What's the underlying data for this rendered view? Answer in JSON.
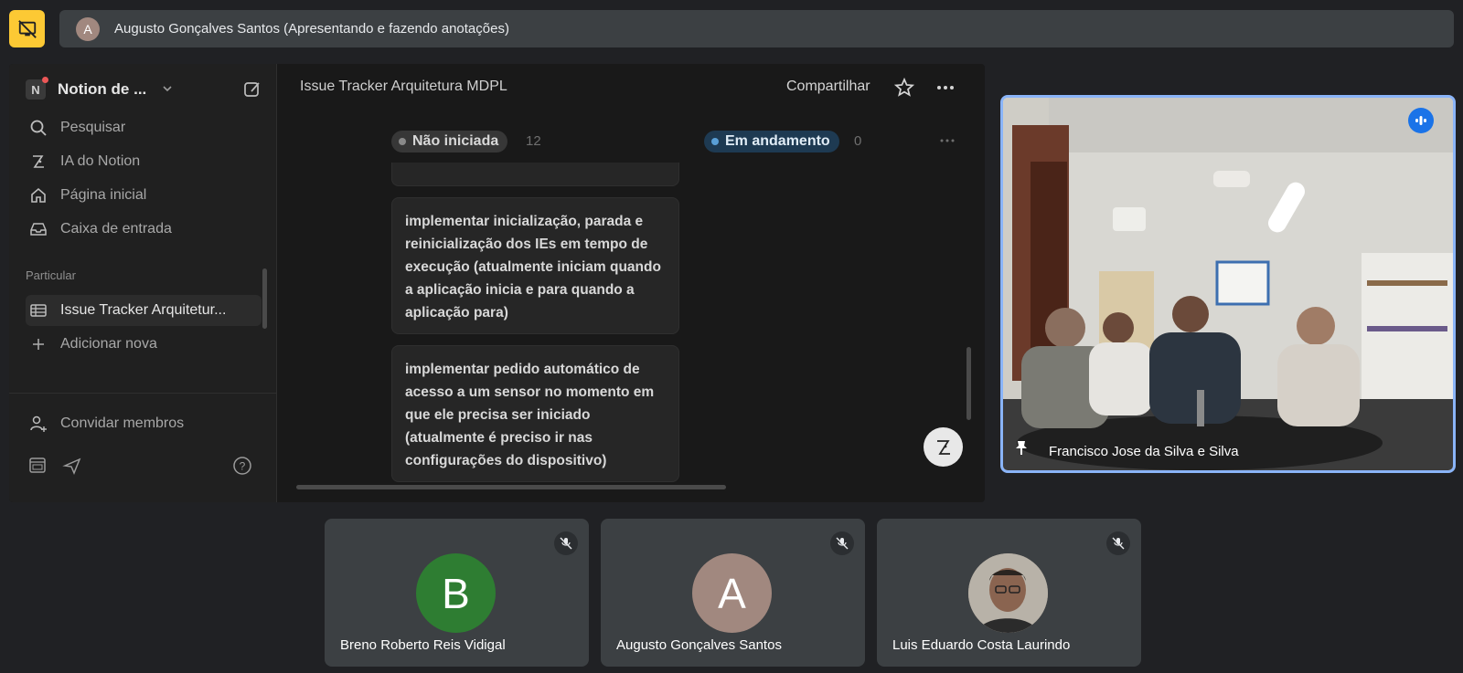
{
  "presenter_bar": {
    "avatar_letter": "A",
    "text": "Augusto Gonçalves Santos (Apresentando e fazendo anotações)"
  },
  "notion": {
    "workspace": {
      "logo_letter": "N",
      "name": "Notion de ..."
    },
    "sidebar": {
      "items": [
        {
          "label": "Pesquisar",
          "icon": "search-icon"
        },
        {
          "label": "IA do Notion",
          "icon": "notion-ai-icon"
        },
        {
          "label": "Página inicial",
          "icon": "home-icon"
        },
        {
          "label": "Caixa de entrada",
          "icon": "inbox-icon"
        }
      ],
      "section_label": "Particular",
      "private_items": [
        {
          "label": "Issue Tracker Arquitetur...",
          "icon": "table-icon",
          "active": true
        },
        {
          "label": "Adicionar nova",
          "icon": "plus-icon"
        }
      ],
      "invite_label": "Convidar membros"
    },
    "header": {
      "title": "Issue Tracker Arquitetura MDPL",
      "share_label": "Compartilhar"
    },
    "board": {
      "groups": [
        {
          "label": "Não iniciada",
          "count": "12",
          "color": "#8a8a8a",
          "bg": "#373737"
        },
        {
          "label": "Em andamento",
          "count": "0",
          "color": "#5a9fd6",
          "bg": "#1e3a52"
        }
      ],
      "cards": [
        "implementar inicialização, parada e reinicialização dos IEs em tempo de execução (atualmente iniciam quando a aplicação inicia e para quando a aplicação para)",
        "implementar pedido automático de acesso a um sensor no momento em que ele precisa ser iniciado (atualmente é preciso ir nas configurações do dispositivo)"
      ]
    }
  },
  "pinned_video": {
    "name": "Francisco Jose da Silva e Silva",
    "border_color": "#8ab4f8"
  },
  "participants": [
    {
      "name": "Breno Roberto Reis Vidigal",
      "letter": "B",
      "avatar_color": "#2e7d32",
      "muted": true
    },
    {
      "name": "Augusto Gonçalves Santos",
      "letter": "A",
      "avatar_color": "#a1887f",
      "muted": true
    },
    {
      "name": "Luis Eduardo Costa Laurindo",
      "letter": "",
      "avatar_color": "#9e8f80",
      "muted": true
    }
  ]
}
